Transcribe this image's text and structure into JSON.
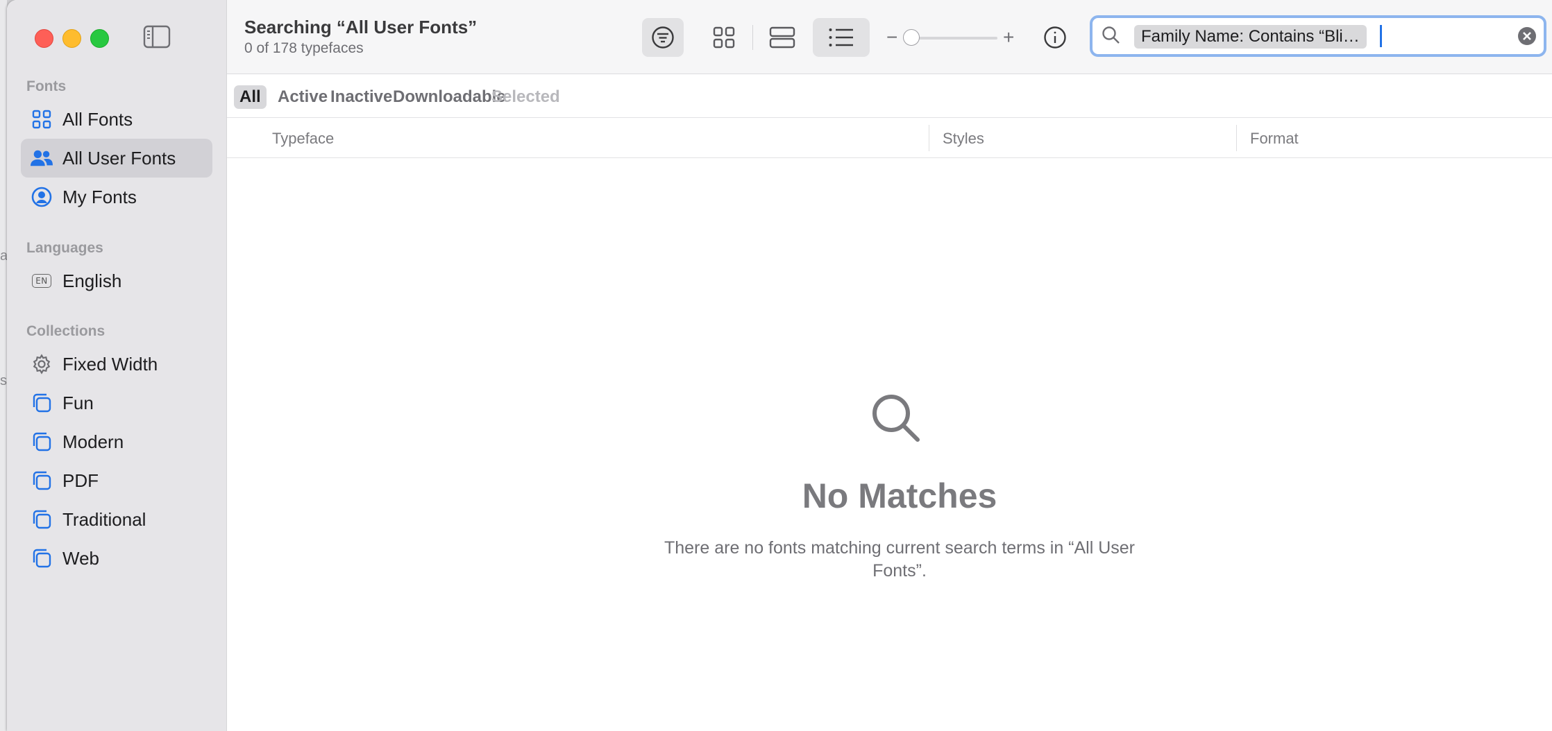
{
  "window": {
    "title": "Searching “All User Fonts”",
    "subtitle": "0 of 178 typefaces"
  },
  "sidebar": {
    "sections": [
      {
        "header": "Fonts",
        "items": [
          {
            "label": "All Fonts",
            "icon": "grid-icon"
          },
          {
            "label": "All User Fonts",
            "icon": "users-icon",
            "selected": true
          },
          {
            "label": "My Fonts",
            "icon": "person-circle-icon"
          }
        ]
      },
      {
        "header": "Languages",
        "items": [
          {
            "label": "English",
            "icon": "en-badge-icon",
            "badge": "EN"
          }
        ]
      },
      {
        "header": "Collections",
        "items": [
          {
            "label": "Fixed Width",
            "icon": "gear-icon"
          },
          {
            "label": "Fun",
            "icon": "collection-icon"
          },
          {
            "label": "Modern",
            "icon": "collection-icon"
          },
          {
            "label": "PDF",
            "icon": "collection-icon"
          },
          {
            "label": "Traditional",
            "icon": "collection-icon"
          },
          {
            "label": "Web",
            "icon": "collection-icon"
          }
        ]
      }
    ]
  },
  "toolbar": {
    "view_mode_selected": "list",
    "search": {
      "token": "Family Name: Contains “Bli…",
      "value": ""
    }
  },
  "filters": {
    "items": [
      "All",
      "Active",
      "Inactive",
      "Downloadable",
      "Selected"
    ],
    "selected": "All",
    "disabled": "Selected"
  },
  "columns": [
    "Typeface",
    "Styles",
    "Format"
  ],
  "empty_state": {
    "title": "No Matches",
    "message": "There are no fonts matching current search terms in “All User Fonts”."
  },
  "colors": {
    "accent": "#2272e6",
    "close": "#fe5f57",
    "minimize": "#febc2e",
    "maximize": "#28c840"
  }
}
